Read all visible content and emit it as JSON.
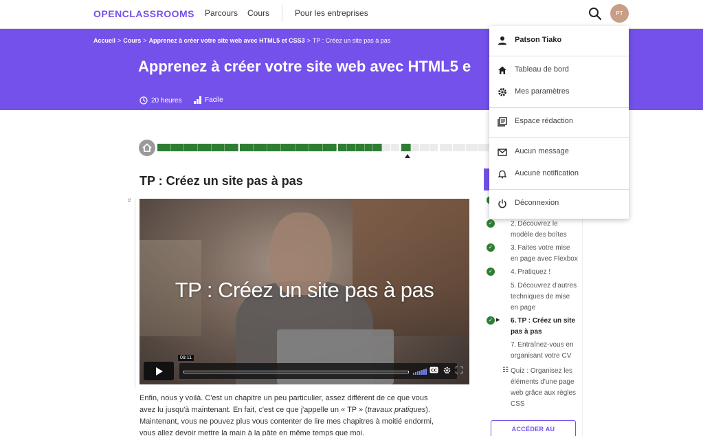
{
  "nav": {
    "logo": "OPENCLASSROOMS",
    "links": [
      "Parcours",
      "Cours",
      "Pour les entreprises"
    ],
    "avatar_initials": "PT",
    "accent": "#7451eb"
  },
  "hero": {
    "breadcrumb": [
      "Accueil",
      "Cours",
      "Apprenez à créer votre site web avec HTML5 et CSS3",
      "TP : Créez un site pas à pas"
    ],
    "title": "Apprenez à créer votre site web avec HTML5 e",
    "duration": "20 heures",
    "level": "Facile"
  },
  "progress": {
    "segments": [
      {
        "done": 6,
        "todo": 0
      },
      {
        "done": 7,
        "todo": 0
      },
      {
        "done": 5,
        "todo": 2
      },
      {
        "done": 1,
        "todo": 3
      },
      {
        "done": 0,
        "todo": 4
      }
    ]
  },
  "chapter": {
    "title": "TP : Créez un site pas à pas",
    "hash": "#",
    "video": {
      "caption": "TP : Créez un site pas à pas",
      "timecode": "09:11"
    },
    "body_line1": "Enfin, nous y voilà. C'est un chapitre un peu particulier, assez différent de ce que vous",
    "body_line2_a": "avez lu jusqu'à maintenant. En fait, c'est ce que j'appelle un « TP » (",
    "body_line2_em": "travaux pratiques",
    "body_line2_b": ").",
    "body_line3": "Maintenant, vous ne pouvez plus vous contenter de lire mes chapitres à moitié endormi,",
    "body_line4": "vous allez devoir mettre la main à la pâte en même temps que moi."
  },
  "toc": {
    "items": [
      {
        "num": "2.",
        "label": "Découvrez le modèle des boîtes",
        "checked": true,
        "active": false
      },
      {
        "num": "3.",
        "label": "Faites votre mise en page avec Flexbox",
        "checked": true,
        "active": false
      },
      {
        "num": "4.",
        "label": "Pratiquez !",
        "checked": true,
        "active": false
      },
      {
        "num": "5.",
        "label": "Découvrez d'autres techniques de mise en page",
        "checked": false,
        "active": false
      },
      {
        "num": "6.",
        "label": "TP : Créez un site pas à pas",
        "checked": true,
        "active": true
      },
      {
        "num": "7.",
        "label": "Entraînez-vous en organisant votre CV",
        "checked": false,
        "active": false
      }
    ],
    "quiz": "Quiz : Organisez les éléments d'une page web grâce aux règles CSS",
    "access_button": "ACCÉDER AU"
  },
  "dropdown": {
    "user": "Patson Tiako",
    "dashboard": "Tableau de bord",
    "settings": "Mes paramètres",
    "writing": "Espace rédaction",
    "messages": "Aucun message",
    "notifications": "Aucune notification",
    "logout": "Déconnexion"
  }
}
